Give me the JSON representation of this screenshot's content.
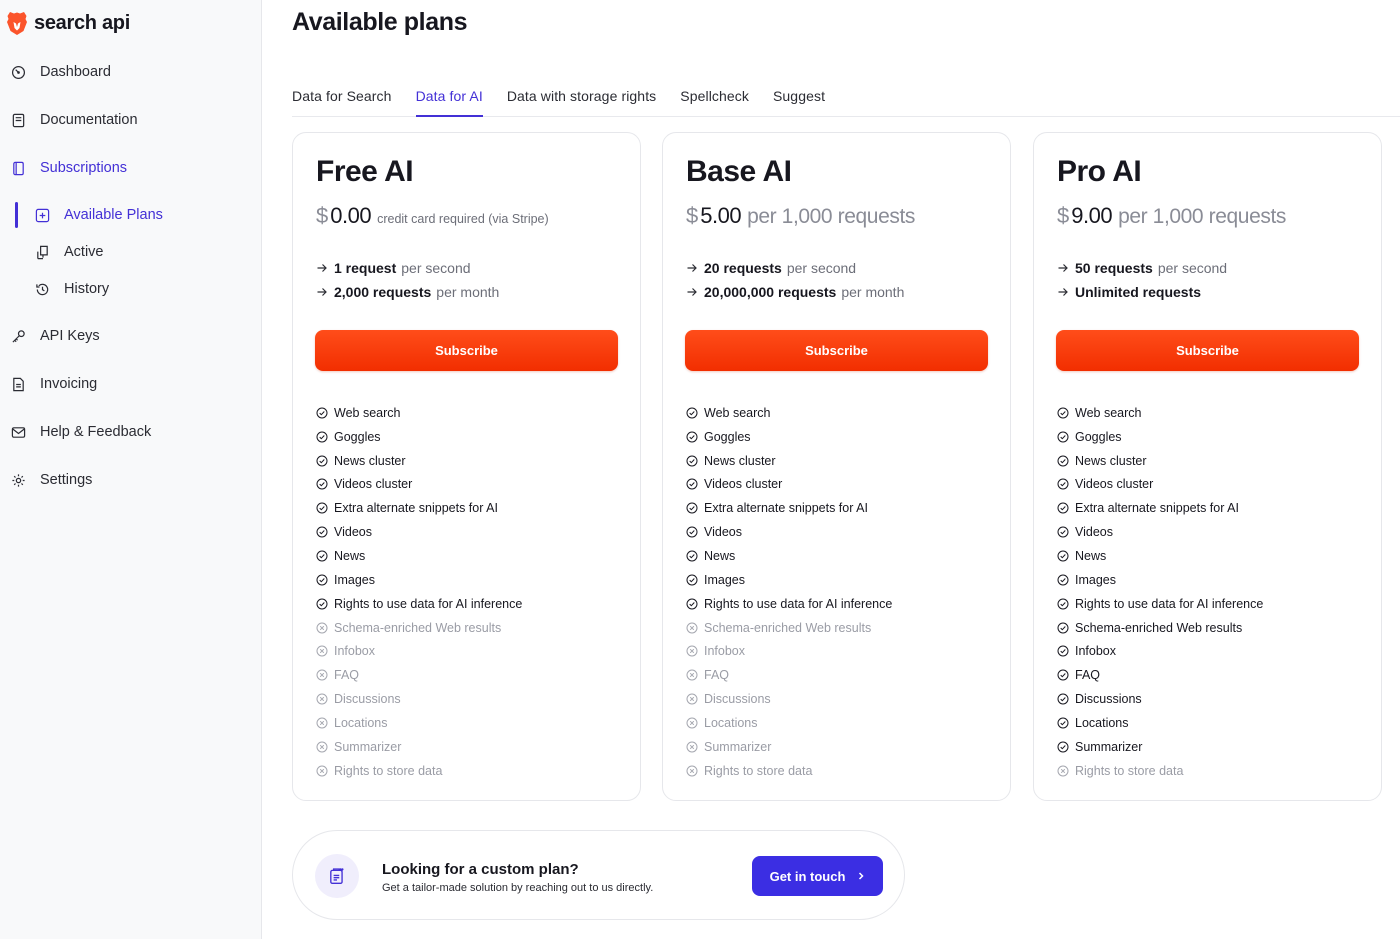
{
  "app": {
    "logo_text": "search api"
  },
  "sidebar": {
    "items": [
      {
        "label": "Dashboard",
        "icon": "dashboard-gauge-icon"
      },
      {
        "label": "Documentation",
        "icon": "book-icon"
      },
      {
        "label": "Subscriptions",
        "icon": "card-icon",
        "active": true
      },
      {
        "label": "API Keys",
        "icon": "key-icon"
      },
      {
        "label": "Invoicing",
        "icon": "document-icon"
      },
      {
        "label": "Help & Feedback",
        "icon": "mail-icon"
      },
      {
        "label": "Settings",
        "icon": "gear-icon"
      }
    ],
    "sub_items": [
      {
        "label": "Available Plans",
        "icon": "plus-square-icon",
        "active": true
      },
      {
        "label": "Active",
        "icon": "plug-icon"
      },
      {
        "label": "History",
        "icon": "history-icon"
      }
    ]
  },
  "main": {
    "title": "Available plans",
    "tabs": [
      {
        "label": "Data for Search"
      },
      {
        "label": "Data for AI",
        "active": true
      },
      {
        "label": "Data with storage rights"
      },
      {
        "label": "Spellcheck"
      },
      {
        "label": "Suggest"
      }
    ]
  },
  "plans": [
    {
      "name": "Free AI",
      "currency": "$",
      "amount": "0.00",
      "price_note": "credit card required (via Stripe)",
      "limits": [
        {
          "strong": "1 request",
          "rest": "per second"
        },
        {
          "strong": "2,000 requests",
          "rest": "per month"
        }
      ],
      "button": "Subscribe",
      "features": [
        {
          "label": "Web search",
          "included": true
        },
        {
          "label": "Goggles",
          "included": true
        },
        {
          "label": "News cluster",
          "included": true
        },
        {
          "label": "Videos cluster",
          "included": true
        },
        {
          "label": "Extra alternate snippets for AI",
          "included": true
        },
        {
          "label": "Videos",
          "included": true
        },
        {
          "label": "News",
          "included": true
        },
        {
          "label": "Images",
          "included": true
        },
        {
          "label": "Rights to use data for AI inference",
          "included": true
        },
        {
          "label": "Schema-enriched Web results",
          "included": false
        },
        {
          "label": "Infobox",
          "included": false
        },
        {
          "label": "FAQ",
          "included": false
        },
        {
          "label": "Discussions",
          "included": false
        },
        {
          "label": "Locations",
          "included": false
        },
        {
          "label": "Summarizer",
          "included": false
        },
        {
          "label": "Rights to store data",
          "included": false
        }
      ]
    },
    {
      "name": "Base AI",
      "currency": "$",
      "amount": "5.00",
      "price_note": "per 1,000 requests",
      "limits": [
        {
          "strong": "20 requests",
          "rest": "per second"
        },
        {
          "strong": "20,000,000 requests",
          "rest": "per month"
        }
      ],
      "button": "Subscribe",
      "features": [
        {
          "label": "Web search",
          "included": true
        },
        {
          "label": "Goggles",
          "included": true
        },
        {
          "label": "News cluster",
          "included": true
        },
        {
          "label": "Videos cluster",
          "included": true
        },
        {
          "label": "Extra alternate snippets for AI",
          "included": true
        },
        {
          "label": "Videos",
          "included": true
        },
        {
          "label": "News",
          "included": true
        },
        {
          "label": "Images",
          "included": true
        },
        {
          "label": "Rights to use data for AI inference",
          "included": true
        },
        {
          "label": "Schema-enriched Web results",
          "included": false
        },
        {
          "label": "Infobox",
          "included": false
        },
        {
          "label": "FAQ",
          "included": false
        },
        {
          "label": "Discussions",
          "included": false
        },
        {
          "label": "Locations",
          "included": false
        },
        {
          "label": "Summarizer",
          "included": false
        },
        {
          "label": "Rights to store data",
          "included": false
        }
      ]
    },
    {
      "name": "Pro AI",
      "currency": "$",
      "amount": "9.00",
      "price_note": "per 1,000 requests",
      "limits": [
        {
          "strong": "50 requests",
          "rest": "per second"
        },
        {
          "strong": "Unlimited requests",
          "rest": ""
        }
      ],
      "button": "Subscribe",
      "features": [
        {
          "label": "Web search",
          "included": true
        },
        {
          "label": "Goggles",
          "included": true
        },
        {
          "label": "News cluster",
          "included": true
        },
        {
          "label": "Videos cluster",
          "included": true
        },
        {
          "label": "Extra alternate snippets for AI",
          "included": true
        },
        {
          "label": "Videos",
          "included": true
        },
        {
          "label": "News",
          "included": true
        },
        {
          "label": "Images",
          "included": true
        },
        {
          "label": "Rights to use data for AI inference",
          "included": true
        },
        {
          "label": "Schema-enriched Web results",
          "included": true
        },
        {
          "label": "Infobox",
          "included": true
        },
        {
          "label": "FAQ",
          "included": true
        },
        {
          "label": "Discussions",
          "included": true
        },
        {
          "label": "Locations",
          "included": true
        },
        {
          "label": "Summarizer",
          "included": true
        },
        {
          "label": "Rights to store data",
          "included": false
        }
      ]
    }
  ],
  "custom_plan": {
    "title": "Looking for a custom plan?",
    "subtitle": "Get a tailor-made solution by reaching out to us directly.",
    "button": "Get in touch",
    "icon": "clipboard-heart-icon"
  },
  "colors": {
    "accent": "#4330d6",
    "subscribe": "#f22e00",
    "brand": "#fb542b",
    "cta": "#3b2ee3"
  }
}
